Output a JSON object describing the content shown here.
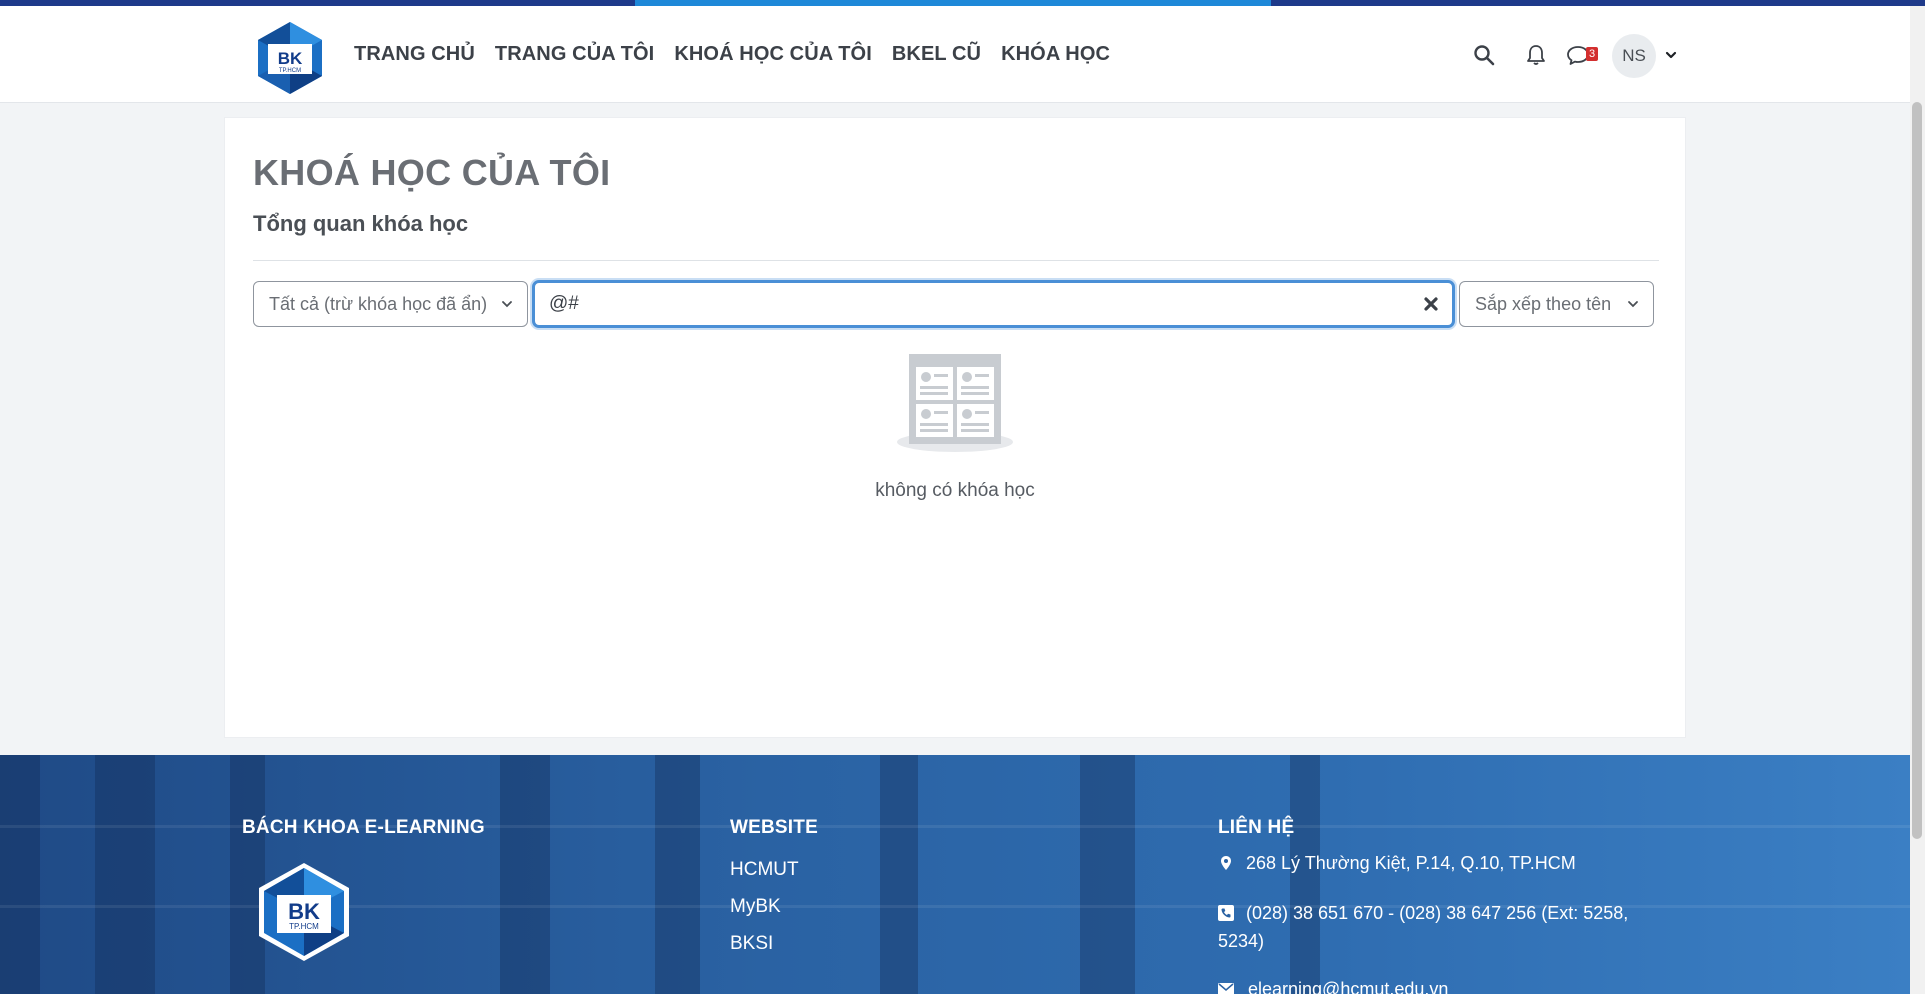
{
  "navbar": {
    "logo_text": "BK",
    "logo_subtext": "TP.HCM",
    "links": [
      "TRANG CHỦ",
      "TRANG CỦA TÔI",
      "KHOÁ HỌC CỦA TÔI",
      "BKEL CŨ",
      "KHÓA HỌC"
    ],
    "messages_badge": "3",
    "avatar_initials": "NS"
  },
  "main": {
    "page_title": "KHOÁ HỌC CỦA TÔI",
    "section_title": "Tổng quan khóa học",
    "filter_label": "Tất cả (trừ khóa học đã ẩn)",
    "search_value": "@#",
    "sort_label": "Sắp xếp theo tên",
    "empty_message": "không có khóa học"
  },
  "footer": {
    "brand_heading": "BÁCH KHOA E-LEARNING",
    "website_heading": "WEBSITE",
    "website_links": [
      "HCMUT",
      "MyBK",
      "BKSI"
    ],
    "contact_heading": "LIÊN HỆ",
    "address": "268 Lý Thường Kiệt, P.14, Q.10, TP.HCM",
    "phone_line1": "(028) 38 651 670 - (028) 38 647 256 (Ext: 5258,",
    "phone_line2": "5234)",
    "email": "elearning@hcmut.edu.vn"
  },
  "colors": {
    "brand_blue": "#1e3a8a",
    "accent_blue": "#1e88d8",
    "focus_blue": "#4a8fd6",
    "badge_red": "#d32f2f"
  },
  "icons": [
    "search-icon",
    "bell-icon",
    "chat-icon",
    "chevron-down-icon",
    "times-icon",
    "map-marker-icon",
    "phone-icon",
    "envelope-icon"
  ]
}
